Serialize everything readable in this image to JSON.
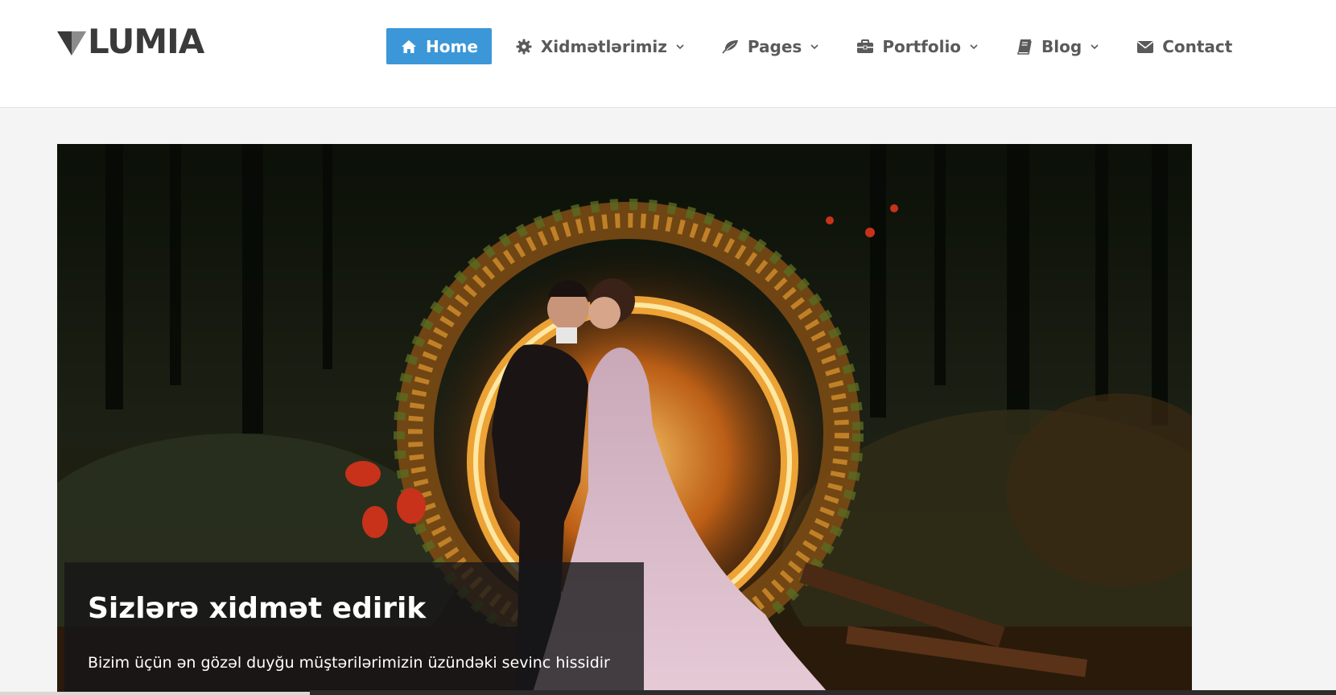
{
  "brand": {
    "name": "LUMIA",
    "text_color": "#3a3a3a"
  },
  "nav": {
    "items": [
      {
        "label": "Home",
        "icon": "home-icon",
        "active": true,
        "dropdown": false
      },
      {
        "label": "Xidmətlərimiz",
        "icon": "gear-icon",
        "active": false,
        "dropdown": true
      },
      {
        "label": "Pages",
        "icon": "leaf-icon",
        "active": false,
        "dropdown": true
      },
      {
        "label": "Portfolio",
        "icon": "briefcase-icon",
        "active": false,
        "dropdown": true
      },
      {
        "label": "Blog",
        "icon": "book-icon",
        "active": false,
        "dropdown": true
      },
      {
        "label": "Contact",
        "icon": "envelope-icon",
        "active": false,
        "dropdown": false
      }
    ],
    "active_color": "#3c97d8",
    "text_color": "#5a5a5a"
  },
  "hero": {
    "caption": {
      "title": "Sizlərə xidmət edirik",
      "text": "Bizim üçün ən gözəl duyğu müştərilərimizin üzündəki sevinc hissidir"
    }
  }
}
